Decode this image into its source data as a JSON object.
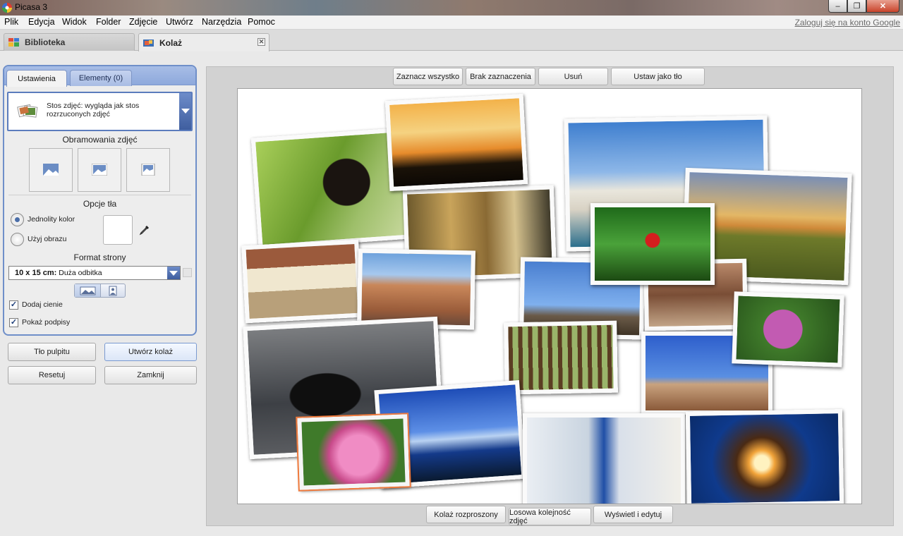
{
  "window": {
    "title": "Picasa 3",
    "min": "–",
    "max": "❐",
    "close": "✕"
  },
  "menu": {
    "items": [
      "Plik",
      "Edycja",
      "Widok",
      "Folder",
      "Zdjęcie",
      "Utwórz",
      "Narzędzia",
      "Pomoc"
    ],
    "login": "Zaloguj się na konto Google"
  },
  "tabs": {
    "library": "Biblioteka",
    "collage": "Kolaż",
    "close": "✕"
  },
  "panel": {
    "tab_settings": "Ustawienia",
    "tab_elements": "Elementy (0)",
    "style": "Stos zdjęć: wygląda jak stos rozrzuconych zdjęć",
    "borders_title": "Obramowania zdjęć",
    "background_title": "Opcje tła",
    "radio_solid": "Jednolity kolor",
    "radio_image": "Użyj obrazu",
    "format_title": "Format strony",
    "format_size": "10 x 15 cm:",
    "format_name": "Duża odbitka",
    "shadows": "Dodaj cienie",
    "captions": "Pokaż podpisy",
    "check_mark": "✓"
  },
  "actions": {
    "desktop_bg": "Tło pulpitu",
    "create": "Utwórz kolaż",
    "reset": "Resetuj",
    "close": "Zamknij"
  },
  "toolbar": {
    "select_all": "Zaznacz wszystko",
    "select_none": "Brak zaznaczenia",
    "remove": "Usuń",
    "set_bg": "Ustaw jako tło"
  },
  "bottom": {
    "scattered": "Kolaż rozproszony",
    "shuffle": "Losowa kolejność zdjęć",
    "view_edit": "Wyświetl i edytuj"
  },
  "photos": [
    {
      "name": "cat-on-grass"
    },
    {
      "name": "sunset-silhouette"
    },
    {
      "name": "harbor-buildings"
    },
    {
      "name": "sunflower-field"
    },
    {
      "name": "pottery-market"
    },
    {
      "name": "red-berries"
    },
    {
      "name": "village-street"
    },
    {
      "name": "rome-rooftops"
    },
    {
      "name": "statues-balustrade"
    },
    {
      "name": "ruins-arches"
    },
    {
      "name": "hydrangea-purple"
    },
    {
      "name": "birch-forest"
    },
    {
      "name": "black-white-kitten"
    },
    {
      "name": "stone-columns"
    },
    {
      "name": "sky-rays"
    },
    {
      "name": "pink-flowers"
    },
    {
      "name": "blue-lantern"
    },
    {
      "name": "sun-window"
    }
  ]
}
